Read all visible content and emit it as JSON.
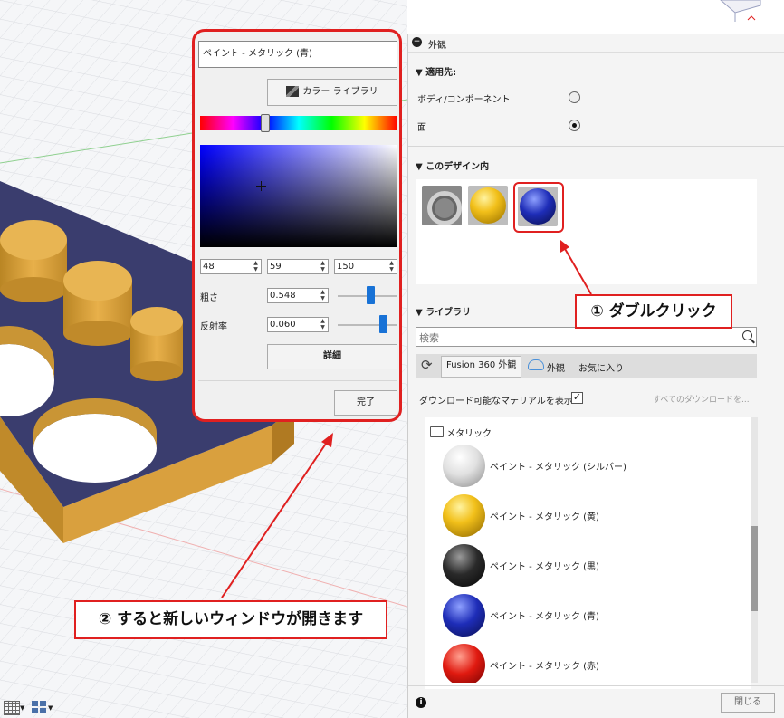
{
  "picker": {
    "material_name": "ペイント - メタリック (青)",
    "color_library_label": "カラー ライブラリ",
    "rgb": [
      "48",
      "59",
      "150"
    ],
    "roughness_label": "粗さ",
    "roughness_value": "0.548",
    "roughness_level": 0.55,
    "reflectance_label": "反射率",
    "reflectance_value": "0.060",
    "reflectance_level": 0.75,
    "details_button": "詳細",
    "done_button": "完了"
  },
  "panel": {
    "title": "外観",
    "apply_to_header": "適用先:",
    "apply_options": [
      "ボディ/コンポーネント",
      "面"
    ],
    "in_design_header": "このデザイン内",
    "library_header": "ライブラリ",
    "search_placeholder": "検索",
    "tabs": [
      "Fusion 360 外観",
      "外観",
      "お気に入り"
    ],
    "show_downloadable_label": "ダウンロード可能なマテリアルを表示",
    "all_downloads_link": "すべてのダウンロードを...",
    "folder_label": "メタリック",
    "library_items": [
      "ペイント - メタリック (シルバー)",
      "ペイント - メタリック (黄)",
      "ペイント - メタリック (黒)",
      "ペイント - メタリック (青)",
      "ペイント - メタリック (赤)"
    ],
    "close_button": "閉じる"
  },
  "callouts": {
    "double_click": "① ダブルクリック",
    "new_window": "② すると新しいウィンドウが開きます"
  },
  "colors": {
    "accent_red": "#e02020",
    "selected_blue": "#1872d6",
    "plate_navy": "#3a3d6e",
    "cylinder_gold": "#e0a73a"
  }
}
